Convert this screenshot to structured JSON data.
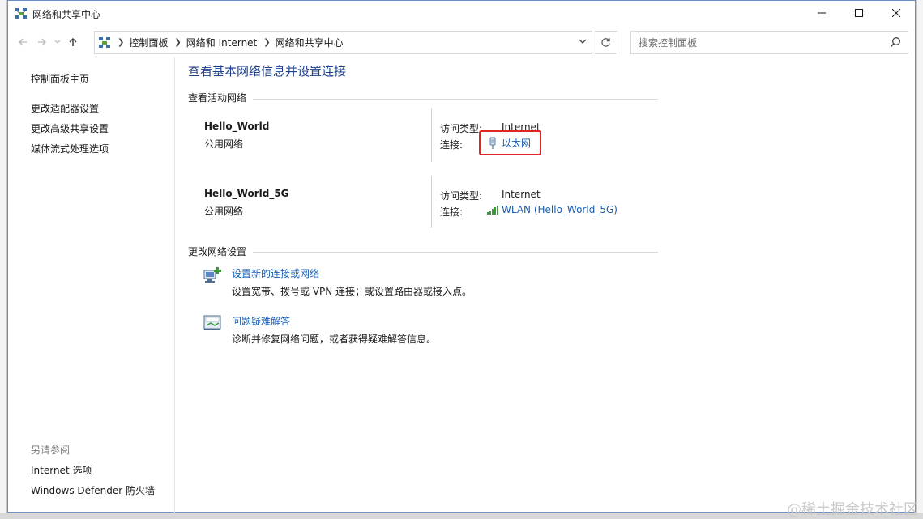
{
  "window": {
    "title": "网络和共享中心"
  },
  "address": {
    "crumbs": [
      "控制面板",
      "网络和 Internet",
      "网络和共享中心"
    ]
  },
  "search": {
    "placeholder": "搜索控制面板"
  },
  "left_pane": {
    "home": "控制面板主页",
    "links": [
      "更改适配器设置",
      "更改高级共享设置",
      "媒体流式处理选项"
    ],
    "see_also_label": "另请参阅",
    "see_also": [
      "Internet 选项",
      "Windows Defender 防火墙"
    ]
  },
  "main": {
    "title": "查看基本网络信息并设置连接",
    "active_networks_heading": "查看活动网络",
    "networks": [
      {
        "name": "Hello_World",
        "category": "公用网络",
        "access_label": "访问类型:",
        "access_value": "Internet",
        "connection_label": "连接:",
        "connection_name": "以太网",
        "connection_icon": "ethernet-icon"
      },
      {
        "name": "Hello_World_5G",
        "category": "公用网络",
        "access_label": "访问类型:",
        "access_value": "Internet",
        "connection_label": "连接:",
        "connection_name": "WLAN (Hello_World_5G)",
        "connection_icon": "wifi-signal-icon"
      }
    ],
    "change_settings_heading": "更改网络设置",
    "tasks": [
      {
        "link": "设置新的连接或网络",
        "desc": "设置宽带、拨号或 VPN 连接；或设置路由器或接入点。",
        "icon": "new-connection-icon"
      },
      {
        "link": "问题疑难解答",
        "desc": "诊断并修复网络问题，或者获得疑难解答信息。",
        "icon": "troubleshoot-icon"
      }
    ]
  },
  "watermark": "@稀土掘金技术社区",
  "colors": {
    "link": "#1a5fb4",
    "title": "#1e3f8c",
    "highlight": "#e0271f"
  }
}
